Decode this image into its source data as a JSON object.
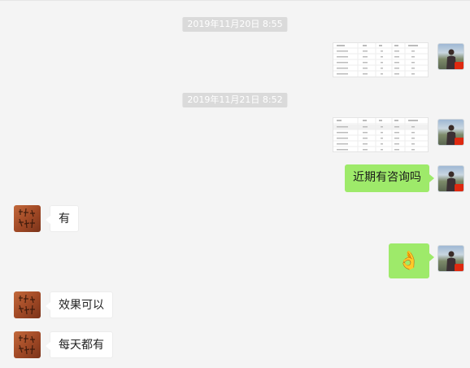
{
  "timestamps": [
    {
      "text": "2019年11月20日 8:55"
    },
    {
      "text": "2019年11月21日 8:52"
    }
  ],
  "messages": {
    "m3": {
      "sender": "me",
      "text": "近期有咨询吗"
    },
    "m4": {
      "sender": "other",
      "text": "有"
    },
    "m5": {
      "sender": "me",
      "emoji": "👌"
    },
    "m6": {
      "sender": "other",
      "text": "效果可以"
    },
    "m7": {
      "sender": "other",
      "text": "每天都有"
    }
  },
  "image_messages": [
    {
      "sender": "me",
      "icon": "spreadsheet-thumbnail"
    },
    {
      "sender": "me",
      "icon": "spreadsheet-thumbnail"
    }
  ],
  "colors": {
    "background": "#f4f4f4",
    "outgoing_bubble": "#9eea6a",
    "incoming_bubble": "#ffffff",
    "timestamp_badge": "#dadada"
  }
}
